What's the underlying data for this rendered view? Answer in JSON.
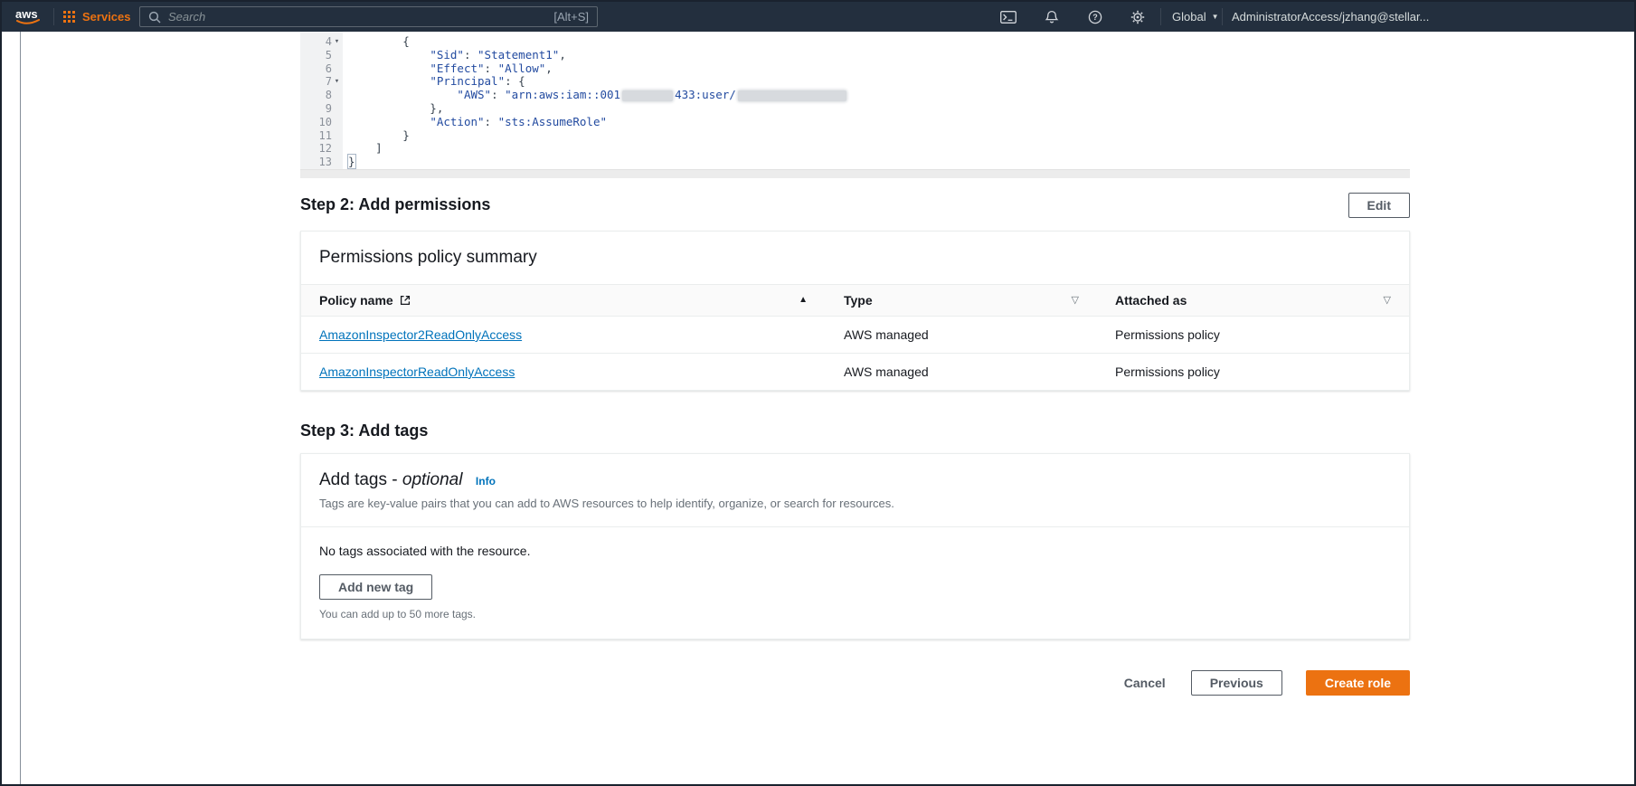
{
  "colors": {
    "topbar_bg": "#232f3e",
    "accent_orange": "#ec7211",
    "link_blue": "#0073bb",
    "text_dark": "#16191f"
  },
  "icons": [
    "aws-logo",
    "services-grid-icon",
    "search-icon",
    "cloudshell-icon",
    "notifications-bell-icon",
    "help-icon",
    "settings-gear-icon",
    "chevron-down-icon",
    "external-link-icon",
    "sort-ascending-icon",
    "filter-icon",
    "code-fold-caret-icon"
  ],
  "topbar": {
    "logo_text": "aws",
    "services_label": "Services",
    "search": {
      "placeholder": "Search",
      "shortcut": "[Alt+S]"
    },
    "region_label": "Global",
    "account_label": "AdministratorAccess/jzhang@stellar..."
  },
  "editor": {
    "lines": [
      {
        "num": "4",
        "fold": true,
        "parts": [
          {
            "t": "        {",
            "s": "p"
          }
        ]
      },
      {
        "num": "5",
        "parts": [
          {
            "t": "            ",
            "s": "p"
          },
          {
            "t": "\"Sid\"",
            "s": "str"
          },
          {
            "t": ": ",
            "s": "p"
          },
          {
            "t": "\"Statement1\"",
            "s": "str"
          },
          {
            "t": ",",
            "s": "p"
          }
        ]
      },
      {
        "num": "6",
        "parts": [
          {
            "t": "            ",
            "s": "p"
          },
          {
            "t": "\"Effect\"",
            "s": "str"
          },
          {
            "t": ": ",
            "s": "p"
          },
          {
            "t": "\"Allow\"",
            "s": "str"
          },
          {
            "t": ",",
            "s": "p"
          }
        ]
      },
      {
        "num": "7",
        "fold": true,
        "parts": [
          {
            "t": "            ",
            "s": "p"
          },
          {
            "t": "\"Principal\"",
            "s": "str"
          },
          {
            "t": ": {",
            "s": "p"
          }
        ]
      },
      {
        "num": "8",
        "parts": [
          {
            "t": "                ",
            "s": "p"
          },
          {
            "t": "\"AWS\"",
            "s": "str"
          },
          {
            "t": ": ",
            "s": "p"
          },
          {
            "t": "\"arn:aws:iam::001",
            "s": "str"
          },
          {
            "r": 56
          },
          {
            "t": "433:user/",
            "s": "str"
          },
          {
            "r": 120
          }
        ]
      },
      {
        "num": "9",
        "parts": [
          {
            "t": "            },",
            "s": "p"
          }
        ]
      },
      {
        "num": "10",
        "parts": [
          {
            "t": "            ",
            "s": "p"
          },
          {
            "t": "\"Action\"",
            "s": "str"
          },
          {
            "t": ": ",
            "s": "p"
          },
          {
            "t": "\"sts:AssumeRole\"",
            "s": "str"
          }
        ]
      },
      {
        "num": "11",
        "parts": [
          {
            "t": "        }",
            "s": "p"
          }
        ]
      },
      {
        "num": "12",
        "parts": [
          {
            "t": "    ]",
            "s": "p"
          }
        ]
      },
      {
        "num": "13",
        "parts": [
          {
            "t": "}",
            "s": "p",
            "m": true
          }
        ]
      }
    ]
  },
  "step2": {
    "title": "Step 2: Add permissions",
    "edit_label": "Edit",
    "card_title": "Permissions policy summary",
    "table": {
      "columns": [
        {
          "label": "Policy name"
        },
        {
          "label": "Type"
        },
        {
          "label": "Attached as"
        }
      ],
      "rows": [
        {
          "policy_name": "AmazonInspector2ReadOnlyAccess",
          "type": "AWS managed",
          "attached_as": "Permissions policy"
        },
        {
          "policy_name": "AmazonInspectorReadOnlyAccess",
          "type": "AWS managed",
          "attached_as": "Permissions policy"
        }
      ]
    }
  },
  "step3": {
    "title": "Step 3: Add tags"
  },
  "tags": {
    "title_prefix": "Add tags - ",
    "title_optional": "optional",
    "info_label": "Info",
    "description": "Tags are key-value pairs that you can add to AWS resources to help identify, organize, or search for resources.",
    "empty_text": "No tags associated with the resource.",
    "add_button_label": "Add new tag",
    "hint": "You can add up to 50 more tags."
  },
  "actions": {
    "cancel_label": "Cancel",
    "previous_label": "Previous",
    "create_label": "Create role"
  }
}
